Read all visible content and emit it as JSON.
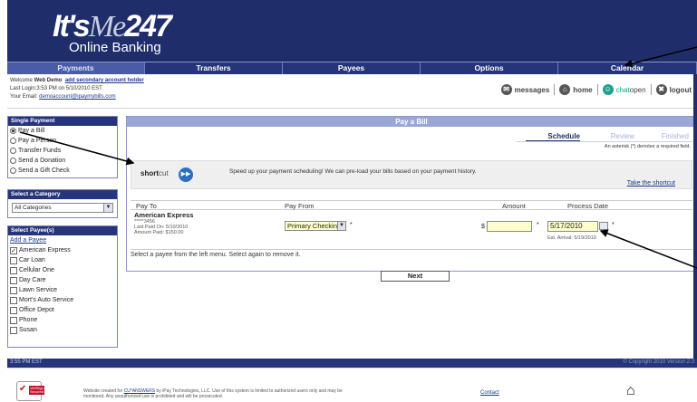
{
  "header": {
    "logo_its": "It's",
    "logo_me": "Me",
    "logo_num": "247",
    "logo_sub": "Online Banking"
  },
  "nav": [
    {
      "label": "Payments",
      "active": true
    },
    {
      "label": "Transfers",
      "active": false
    },
    {
      "label": "Payees",
      "active": false
    },
    {
      "label": "Options",
      "active": false
    },
    {
      "label": "Calendar",
      "active": false
    }
  ],
  "user": {
    "welcome_prefix": "Welcome",
    "name": "Web Demo",
    "add_holder": "add secondary account holder",
    "last_login": "Last Login:3:53 PM on 5/10/2010 EST",
    "email_prefix": "Your Email:",
    "email": "demoaccount@ipaymybills.com"
  },
  "tools": {
    "messages": "messages",
    "home": "home",
    "chat": "chat",
    "chat_status": "open",
    "logout": "logout"
  },
  "sidebar": {
    "single_payment": {
      "title": "Single Payment",
      "options": [
        "Pay a Bill",
        "Pay a Person",
        "Transfer Funds",
        "Send a Donation",
        "Send a Gift Check"
      ],
      "selected": 0
    },
    "category": {
      "title": "Select a Category",
      "value": "All Categories"
    },
    "payees": {
      "title": "Select Payee(s)",
      "add": "Add a Payee",
      "items": [
        {
          "label": "American Express",
          "checked": true
        },
        {
          "label": "Car Loan",
          "checked": false
        },
        {
          "label": "Cellular One",
          "checked": false
        },
        {
          "label": "Day Care",
          "checked": false
        },
        {
          "label": "Lawn Service",
          "checked": false
        },
        {
          "label": "Mort's Auto Service",
          "checked": false
        },
        {
          "label": "Office Depot",
          "checked": false
        },
        {
          "label": "Phone",
          "checked": false
        },
        {
          "label": "Susan",
          "checked": false
        }
      ]
    }
  },
  "main": {
    "title": "Pay a Bill",
    "steps": [
      "Schedule",
      "Review",
      "Finished"
    ],
    "required_note": "An asterisk (*) denotes a required field.",
    "shortcut": {
      "brand_a": "short",
      "brand_b": "cut",
      "message": "Speed up your payment scheduling! We can pre-load your bills based on your payment history.",
      "link": "Take the shortcut"
    },
    "columns": [
      "Pay To",
      "Pay From",
      "Amount",
      "Process Date"
    ],
    "row": {
      "payee": "American Express",
      "account": "*****3456",
      "last_paid": "Last Paid On: 5/10/2010",
      "amount_paid": "Amount Paid: $150.00",
      "pay_from": "Primary Checking",
      "currency": "$",
      "amount": "",
      "date": "5/17/2010",
      "arrival": "Est. Arrival: 5/19/2010",
      "required": "*"
    },
    "note": "Select a payee from the left menu. Select again to remove it.",
    "next": "Next"
  },
  "footer": {
    "time": "3:55 PM EST",
    "copyright": "© Copyright 2010",
    "version": "Version 2.3",
    "verisign_a": "VeriSign",
    "verisign_b": "Secured",
    "legal_prefix": "Website created for",
    "legal_link": "CU*ANSWERS",
    "legal_text": "by iPay Technologies, LLC. Use of this system is limited to authorized users only and may be monitored. Any unauthorized use is prohibited and will be prosecuted.",
    "contact": "Contact"
  }
}
